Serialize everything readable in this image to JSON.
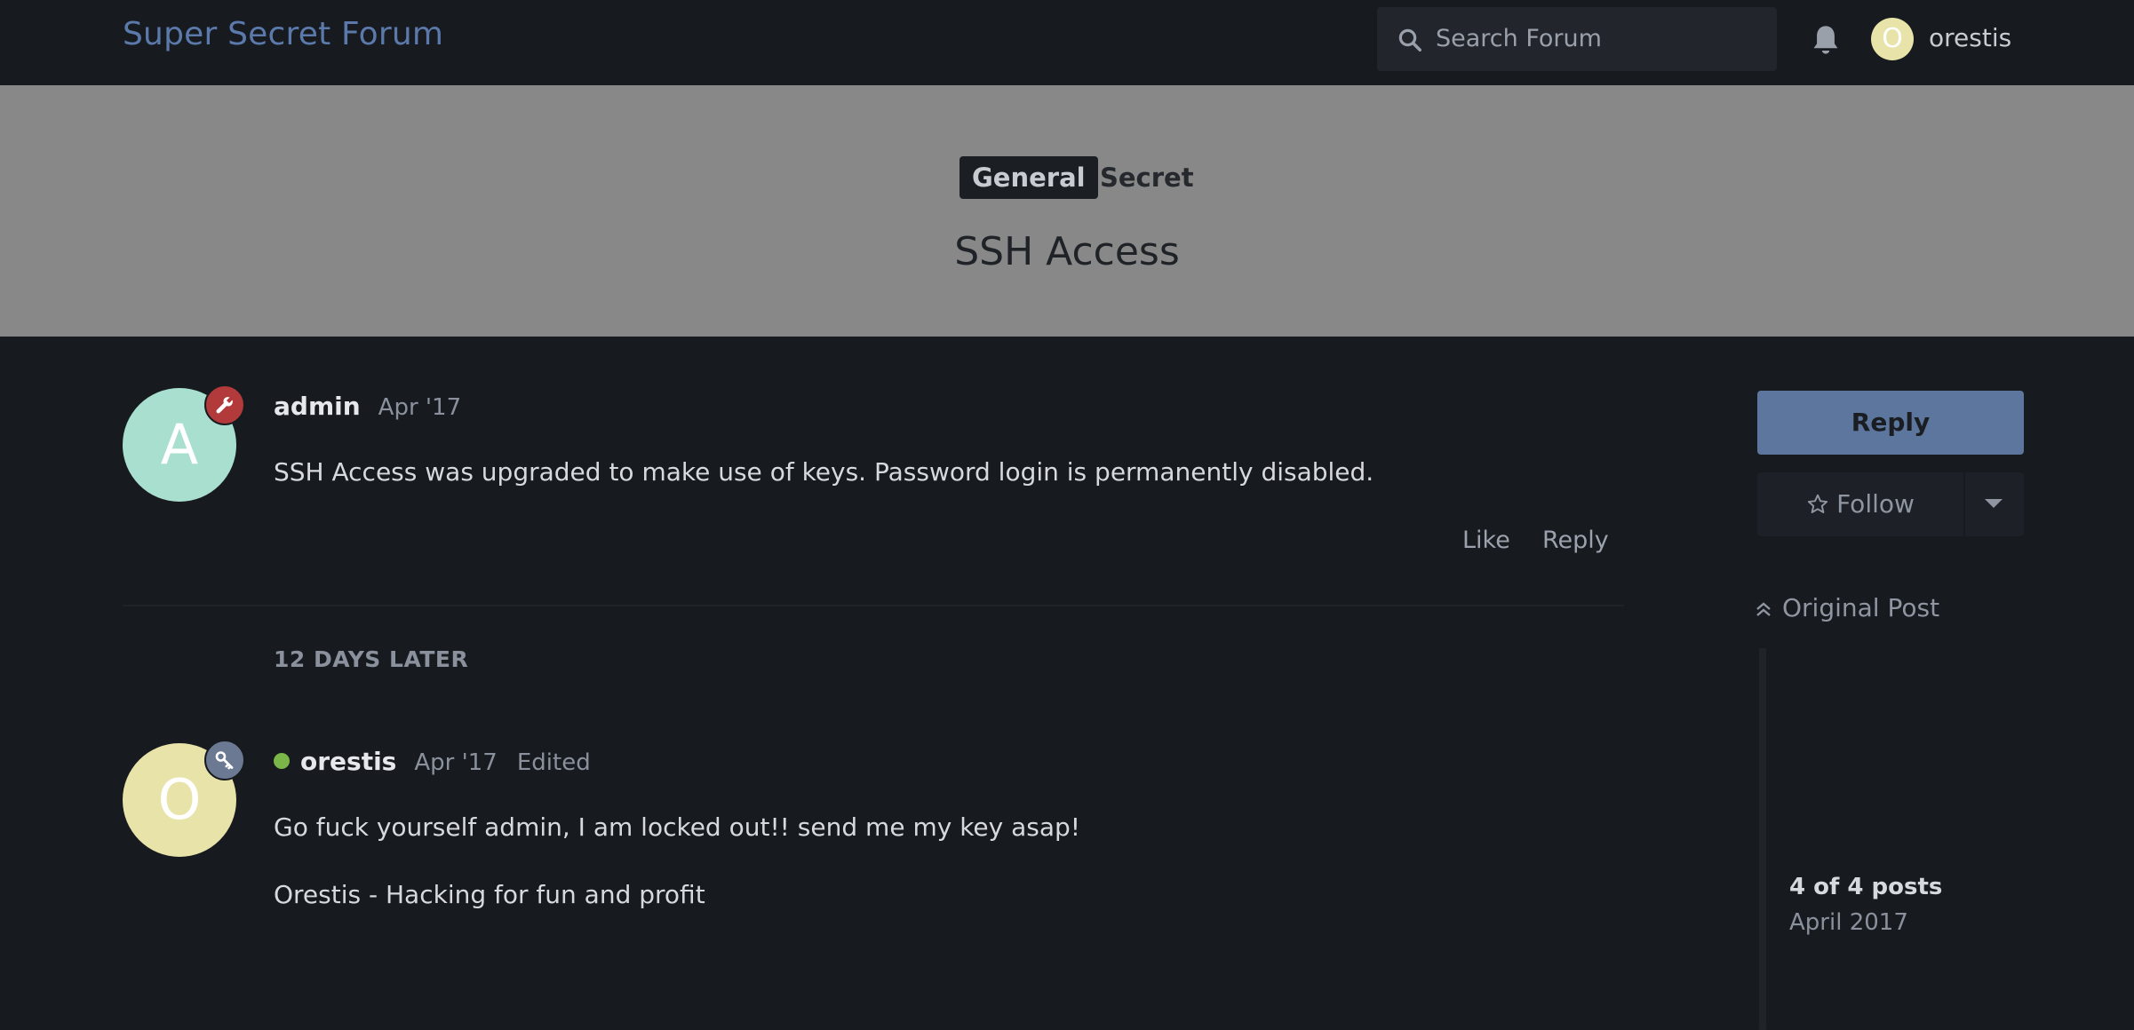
{
  "header": {
    "brand": "Super Secret Forum",
    "search_placeholder": "Search Forum",
    "user_initial": "O",
    "username": "orestis"
  },
  "topic": {
    "tags": [
      "General",
      "Secret"
    ],
    "title": "SSH Access"
  },
  "posts": [
    {
      "initial": "A",
      "author": "admin",
      "date": "Apr '17",
      "body": [
        "SSH Access was upgraded to make use of keys. Password login is permanently disabled."
      ],
      "actions": [
        "Like",
        "Reply"
      ],
      "avatar_color": "#a9dfcf",
      "badge_color": "#b23a3a",
      "badge_icon": "wrench-icon"
    },
    {
      "initial": "O",
      "author": "orestis",
      "date": "Apr '17",
      "edited": "Edited",
      "body": [
        "Go fuck yourself admin, I am locked out!! send me my key asap!",
        "Orestis - Hacking for fun and profit"
      ],
      "avatar_color": "#e8e3a8",
      "badge_color": "#6b7a92",
      "badge_icon": "key-icon",
      "online_color": "#7ab648"
    }
  ],
  "gap_label": "12 DAYS LATER",
  "sidebar": {
    "reply": "Reply",
    "follow": "Follow",
    "original_post": "Original Post",
    "progress": "4 of 4 posts",
    "progress_date": "April 2017"
  },
  "colors": {
    "background": "#171a1f",
    "brand": "#5b7aab",
    "hero": "#888888",
    "reply_button": "#5c769d"
  }
}
